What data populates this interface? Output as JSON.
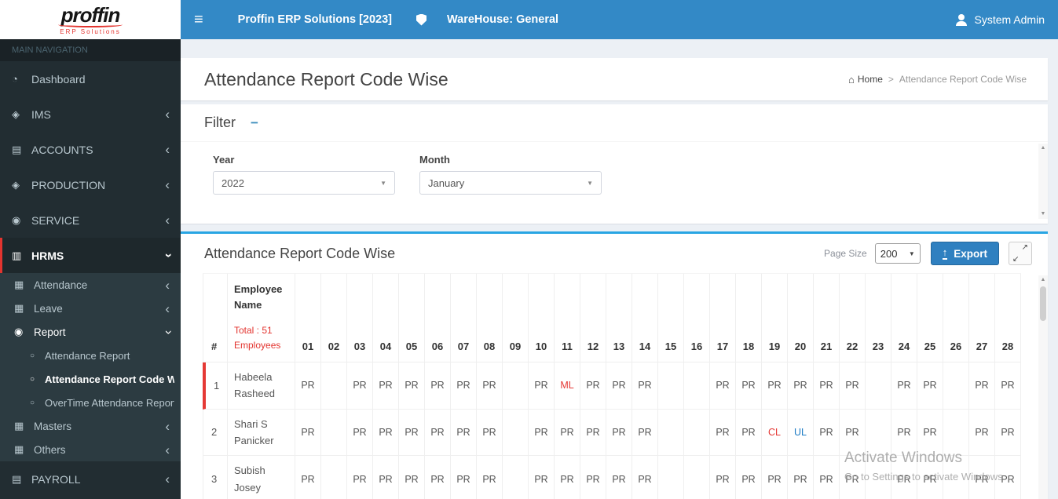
{
  "colors": {
    "navbar-blue": "#3389c6",
    "sidebar-dark": "#222d32",
    "brand-red": "#e3342f",
    "panel-top-border": "#28a5e3",
    "content-bg": "#ecf0f5",
    "export-button": "#2f80c0",
    "code-pr": "#555555",
    "code-ml": "#e53935",
    "code-cl": "#e53935",
    "code-ul": "#1e7bc4"
  },
  "branding": {
    "logo_text": "proffin",
    "logo_subtext": "ERP Solutions"
  },
  "navbar": {
    "app_title": "Proffin ERP Solutions",
    "app_title_suffix": "[2023]",
    "warehouse": "WareHouse: General",
    "user_name": "System Admin",
    "icons": [
      "hamburger-icon",
      "shield-icon",
      "user-icon"
    ]
  },
  "sidebar": {
    "section_label": "MAIN NAVIGATION",
    "items": [
      {
        "label": "Dashboard",
        "icon": "dashboard-icon",
        "glyph": "◔",
        "level": 0,
        "chevron": ""
      },
      {
        "label": "IMS",
        "icon": "share-nodes-icon",
        "glyph": "◈",
        "level": 0,
        "chevron": "left"
      },
      {
        "label": "ACCOUNTS",
        "icon": "list-icon",
        "glyph": "▤",
        "level": 0,
        "chevron": "left"
      },
      {
        "label": "PRODUCTION",
        "icon": "network-icon",
        "glyph": "◈",
        "level": 0,
        "chevron": "left"
      },
      {
        "label": "SERVICE",
        "icon": "user-icon",
        "glyph": "◉",
        "level": 0,
        "chevron": "left"
      },
      {
        "label": "HRMS",
        "icon": "id-card-icon",
        "glyph": "▥",
        "level": 0,
        "chevron": "down",
        "active": true,
        "open": true
      },
      {
        "label": "Attendance",
        "icon": "calendar-icon",
        "glyph": "▦",
        "level": 1,
        "chevron": "left"
      },
      {
        "label": "Leave",
        "icon": "grid-icon",
        "glyph": "▦",
        "level": 1,
        "chevron": "left"
      },
      {
        "label": "Report",
        "icon": "record-icon",
        "glyph": "◉",
        "level": 1,
        "chevron": "down",
        "open": true
      },
      {
        "label": "Attendance Report",
        "icon": "circle-icon",
        "glyph": "○",
        "level": 2,
        "chevron": ""
      },
      {
        "label": "Attendance Report Code Wise",
        "icon": "circle-icon",
        "glyph": "○",
        "level": 2,
        "chevron": "",
        "active": true
      },
      {
        "label": "OverTime Attendance Report",
        "icon": "circle-icon",
        "glyph": "○",
        "level": 2,
        "chevron": ""
      },
      {
        "label": "Masters",
        "icon": "grid-icon",
        "glyph": "▦",
        "level": 1,
        "chevron": "left"
      },
      {
        "label": "Others",
        "icon": "grid-icon",
        "glyph": "▦",
        "level": 1,
        "chevron": "left"
      },
      {
        "label": "PAYROLL",
        "icon": "list-icon",
        "glyph": "▤",
        "level": 0,
        "chevron": "left"
      }
    ]
  },
  "page": {
    "title": "Attendance Report Code Wise",
    "breadcrumb": {
      "home": "Home",
      "separator": ">",
      "current": "Attendance Report Code Wise"
    }
  },
  "filter": {
    "title": "Filter",
    "collapse_icon": "minus-icon",
    "fields": [
      {
        "label": "Year",
        "value": "2022"
      },
      {
        "label": "Month",
        "value": "January"
      }
    ]
  },
  "report": {
    "title": "Attendance Report Code Wise",
    "page_size_label": "Page Size",
    "page_size_value": "200",
    "export_label": "Export",
    "export_icon": "upload-icon",
    "expand_icon": "expand-icon"
  },
  "attendance_table": {
    "col_hash": "#",
    "col_employee": "Employee Name",
    "total_label": "Total : 51 Employees",
    "days": [
      "01",
      "02",
      "03",
      "04",
      "05",
      "06",
      "07",
      "08",
      "09",
      "10",
      "11",
      "12",
      "13",
      "14",
      "15",
      "16",
      "17",
      "18",
      "19",
      "20",
      "21",
      "22",
      "23",
      "24",
      "25",
      "26",
      "27",
      "28"
    ],
    "rows": [
      {
        "num": "1",
        "name": "Habeela Rasheed",
        "highlighted": true,
        "codes": [
          "PR",
          "",
          "PR",
          "PR",
          "PR",
          "PR",
          "PR",
          "PR",
          "",
          "PR",
          "ML",
          "PR",
          "PR",
          "PR",
          "",
          "",
          "PR",
          "PR",
          "PR",
          "PR",
          "PR",
          "PR",
          "",
          "PR",
          "PR",
          "",
          "PR",
          "PR"
        ]
      },
      {
        "num": "2",
        "name": "Shari S Panicker",
        "highlighted": false,
        "codes": [
          "PR",
          "",
          "PR",
          "PR",
          "PR",
          "PR",
          "PR",
          "PR",
          "",
          "PR",
          "PR",
          "PR",
          "PR",
          "PR",
          "",
          "",
          "PR",
          "PR",
          "CL",
          "UL",
          "PR",
          "PR",
          "",
          "PR",
          "PR",
          "",
          "PR",
          "PR"
        ]
      },
      {
        "num": "3",
        "name": "Subish Josey",
        "highlighted": false,
        "codes": [
          "PR",
          "",
          "PR",
          "PR",
          "PR",
          "PR",
          "PR",
          "PR",
          "",
          "PR",
          "PR",
          "PR",
          "PR",
          "PR",
          "",
          "",
          "PR",
          "PR",
          "PR",
          "PR",
          "PR",
          "PR",
          "",
          "PR",
          "PR",
          "",
          "PR",
          "PR"
        ]
      }
    ]
  },
  "watermark": {
    "line1": "Activate Windows",
    "line2": "Go to Settings to activate Windows."
  }
}
